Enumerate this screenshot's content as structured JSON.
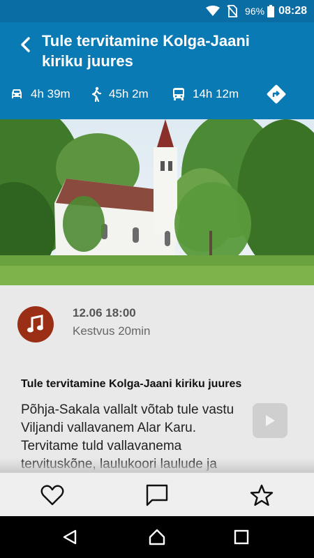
{
  "status_bar": {
    "battery_percent": "96%",
    "time": "08:28",
    "icons": [
      "wifi-icon",
      "no-sim-icon",
      "battery-icon"
    ]
  },
  "header": {
    "title": "Tule tervitamine Kolga-Jaani kiriku juures",
    "back_icon": "chevron-left-icon",
    "travel": {
      "car": "4h 39m",
      "walk": "45h 2m",
      "bus": "14h 12m"
    },
    "directions_icon": "directions-icon"
  },
  "hero_image": "church-photo",
  "event": {
    "datetime": "12.06 18:00",
    "duration": "Kestvus 20min",
    "title": "Tule tervitamine Kolga-Jaani kiriku juures",
    "description": "Põhja-Sakala vallalt võtab tule vastu Viljandi vallavanem Alar Karu. Tervitame tuld vallavanema tervituskõne, laulukoori laulude ja",
    "audio_icon": "music-note-icon",
    "play_icon": "play-icon"
  },
  "actions": [
    "heart-icon",
    "comment-icon",
    "star-icon"
  ],
  "nav": [
    "back-icon",
    "home-icon",
    "recents-icon"
  ],
  "colors": {
    "header_bg": "#0a7ab5",
    "status_bg": "#0a6da3",
    "audio_bg": "#9b2f16"
  }
}
